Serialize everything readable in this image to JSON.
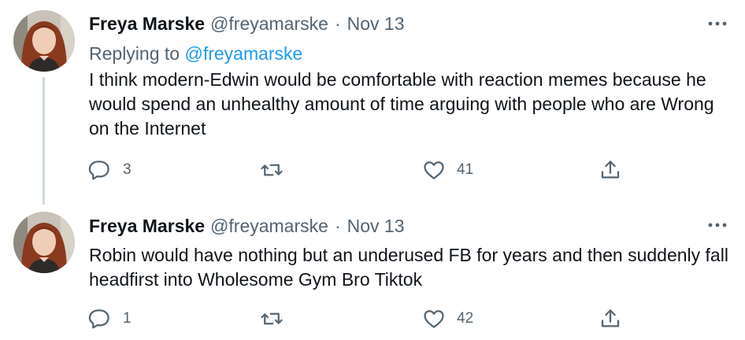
{
  "colors": {
    "text": "#0f1419",
    "secondary": "#536471",
    "link": "#1d9bf0",
    "thread_line": "#cfd9de"
  },
  "tweets": [
    {
      "author": {
        "name": "Freya Marske",
        "handle": "@freyamarske"
      },
      "separator": "·",
      "date": "Nov 13",
      "replying_to": {
        "prefix": "Replying to",
        "mention": "@freyamarske"
      },
      "text": "I think modern-Edwin would be comfortable with reaction memes because he would spend an unhealthy amount of time arguing with people who are Wrong on the Internet",
      "actions": {
        "reply_count": "3",
        "like_count": "41"
      },
      "icons": [
        "avatar",
        "more-icon",
        "reply-icon",
        "retweet-icon",
        "like-icon",
        "share-icon"
      ]
    },
    {
      "author": {
        "name": "Freya Marske",
        "handle": "@freyamarske"
      },
      "separator": "·",
      "date": "Nov 13",
      "text": "Robin would have nothing but an underused FB for years and then suddenly fall headfirst into Wholesome Gym Bro Tiktok",
      "actions": {
        "reply_count": "1",
        "like_count": "42"
      },
      "icons": [
        "avatar",
        "more-icon",
        "reply-icon",
        "retweet-icon",
        "like-icon",
        "share-icon"
      ]
    }
  ]
}
